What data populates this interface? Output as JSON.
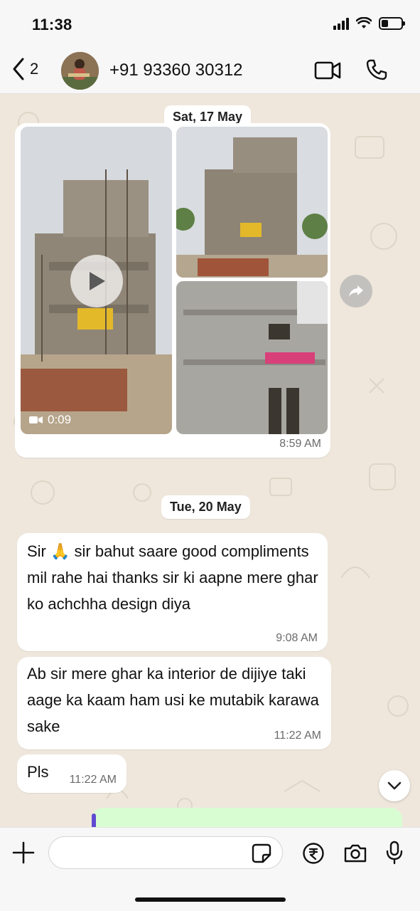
{
  "status_bar": {
    "time": "11:38",
    "battery_level": 0.35
  },
  "header": {
    "back_count": "2",
    "contact_name": "+91 93360 30312",
    "icons": [
      "chevron-left-icon",
      "video-call-icon",
      "phone-icon"
    ]
  },
  "chat": {
    "date_1": "Sat, 17 May",
    "media_message": {
      "video_duration": "0:09",
      "time": "8:59 AM"
    },
    "date_2": "Tue, 20 May",
    "messages": [
      {
        "text": "Sir 🙏 sir bahut saare good compliments mil rahe hai thanks sir ki aapne mere ghar ko achchha design diya",
        "time": "9:08 AM"
      },
      {
        "text": "Ab sir mere ghar ka interior de dijiye taki aage ka kaam ham usi ke mutabik karawa sake",
        "time": "11:22 AM"
      },
      {
        "text": "Pls",
        "time": "11:22 AM"
      }
    ]
  },
  "composer": {
    "placeholder": "",
    "icons": [
      "plus-icon",
      "sticker-icon",
      "rupee-icon",
      "camera-icon",
      "microphone-icon"
    ]
  },
  "colors": {
    "chat_bg": "#efe7dc",
    "bubble": "#ffffff",
    "outgoing": "#d9fdd3",
    "bar": "#f7f7f7"
  }
}
